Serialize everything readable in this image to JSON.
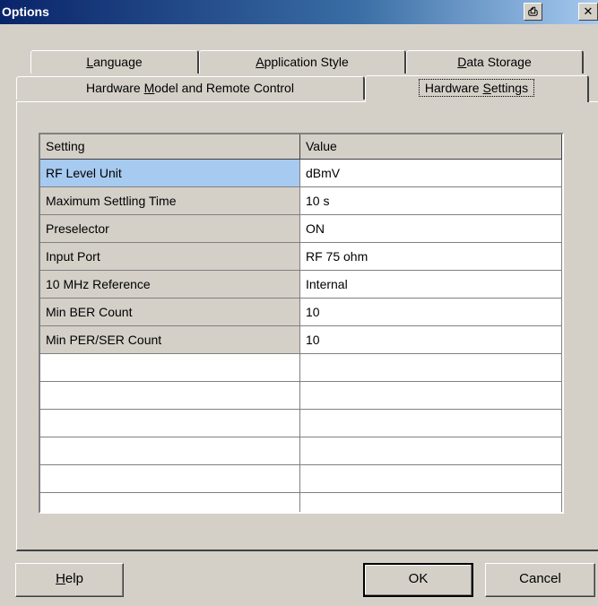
{
  "window": {
    "title": "Options",
    "print_glyph": "⎙",
    "close_glyph": "✕"
  },
  "tabs": {
    "row1": [
      {
        "pre": "",
        "key": "L",
        "post": "anguage"
      },
      {
        "pre": "",
        "key": "A",
        "post": "pplication Style"
      },
      {
        "pre": "",
        "key": "D",
        "post": "ata Storage"
      }
    ],
    "row2": [
      {
        "pre": "Hardware ",
        "key": "M",
        "post": "odel and Remote Control"
      },
      {
        "pre": "Hardware ",
        "key": "S",
        "post": "ettings"
      }
    ]
  },
  "table": {
    "headers": [
      "Setting",
      "Value"
    ],
    "rows": [
      {
        "setting": "RF Level Unit",
        "value": "dBmV"
      },
      {
        "setting": "Maximum Settling Time",
        "value": "10 s"
      },
      {
        "setting": "Preselector",
        "value": "ON"
      },
      {
        "setting": "Input Port",
        "value": "RF 75 ohm"
      },
      {
        "setting": "10 MHz Reference",
        "value": "Internal"
      },
      {
        "setting": "Min BER Count",
        "value": "10"
      },
      {
        "setting": "Min PER/SER Count",
        "value": "10"
      }
    ]
  },
  "buttons": {
    "help": {
      "key": "H",
      "post": "elp"
    },
    "ok": "OK",
    "cancel": "Cancel"
  },
  "colors": {
    "selected_row": "#a6caf0",
    "titlebar": "#0a246a",
    "face": "#d4d0c8"
  }
}
